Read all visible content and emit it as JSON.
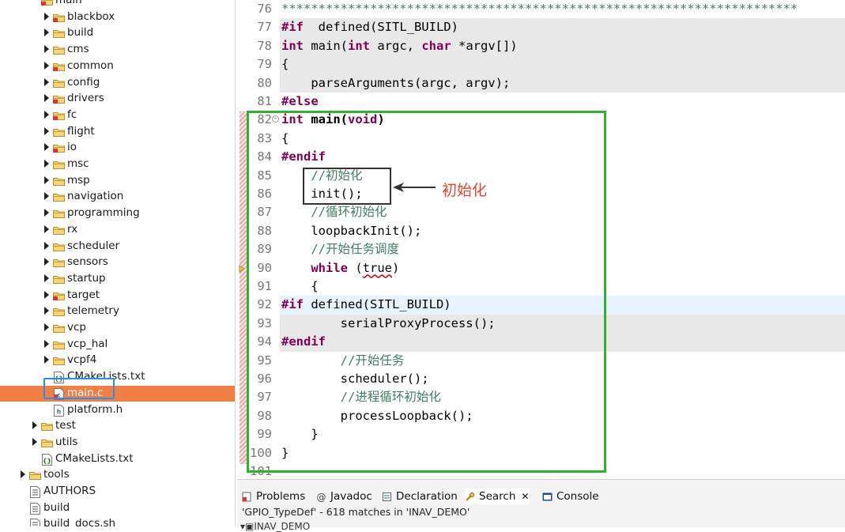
{
  "explorer": {
    "items": [
      {
        "label": "main",
        "type": "folder",
        "depth": 3,
        "arrow": false,
        "overlay": true
      },
      {
        "label": "blackbox",
        "type": "folder",
        "depth": 4,
        "arrow": true,
        "overlay": true
      },
      {
        "label": "build",
        "type": "folder",
        "depth": 4,
        "arrow": true,
        "overlay": false
      },
      {
        "label": "cms",
        "type": "folder",
        "depth": 4,
        "arrow": true,
        "overlay": false
      },
      {
        "label": "common",
        "type": "folder",
        "depth": 4,
        "arrow": true,
        "overlay": true
      },
      {
        "label": "config",
        "type": "folder",
        "depth": 4,
        "arrow": true,
        "overlay": false
      },
      {
        "label": "drivers",
        "type": "folder",
        "depth": 4,
        "arrow": true,
        "overlay": true
      },
      {
        "label": "fc",
        "type": "folder",
        "depth": 4,
        "arrow": true,
        "overlay": true
      },
      {
        "label": "flight",
        "type": "folder",
        "depth": 4,
        "arrow": true,
        "overlay": false
      },
      {
        "label": "io",
        "type": "folder",
        "depth": 4,
        "arrow": true,
        "overlay": true
      },
      {
        "label": "msc",
        "type": "folder",
        "depth": 4,
        "arrow": true,
        "overlay": false
      },
      {
        "label": "msp",
        "type": "folder",
        "depth": 4,
        "arrow": true,
        "overlay": false
      },
      {
        "label": "navigation",
        "type": "folder",
        "depth": 4,
        "arrow": true,
        "overlay": false
      },
      {
        "label": "programming",
        "type": "folder",
        "depth": 4,
        "arrow": true,
        "overlay": false
      },
      {
        "label": "rx",
        "type": "folder",
        "depth": 4,
        "arrow": true,
        "overlay": false
      },
      {
        "label": "scheduler",
        "type": "folder",
        "depth": 4,
        "arrow": true,
        "overlay": false
      },
      {
        "label": "sensors",
        "type": "folder",
        "depth": 4,
        "arrow": true,
        "overlay": false
      },
      {
        "label": "startup",
        "type": "folder",
        "depth": 4,
        "arrow": true,
        "overlay": false
      },
      {
        "label": "target",
        "type": "folder",
        "depth": 4,
        "arrow": true,
        "overlay": true
      },
      {
        "label": "telemetry",
        "type": "folder",
        "depth": 4,
        "arrow": true,
        "overlay": false
      },
      {
        "label": "vcp",
        "type": "folder",
        "depth": 4,
        "arrow": true,
        "overlay": false
      },
      {
        "label": "vcp_hal",
        "type": "folder",
        "depth": 4,
        "arrow": true,
        "overlay": false
      },
      {
        "label": "vcpf4",
        "type": "folder",
        "depth": 4,
        "arrow": true,
        "overlay": false
      },
      {
        "label": "CMakeLists.txt",
        "type": "cmake",
        "depth": 4,
        "arrow": false,
        "overlay": false
      },
      {
        "label": "main.c",
        "type": "cfile",
        "depth": 4,
        "arrow": false,
        "overlay": true,
        "selected": true
      },
      {
        "label": "platform.h",
        "type": "hfile",
        "depth": 4,
        "arrow": false,
        "overlay": false
      },
      {
        "label": "test",
        "type": "folder",
        "depth": 3,
        "arrow": true,
        "overlay": false
      },
      {
        "label": "utils",
        "type": "folder",
        "depth": 3,
        "arrow": true,
        "overlay": false
      },
      {
        "label": "CMakeLists.txt",
        "type": "cmake",
        "depth": 3,
        "arrow": false,
        "overlay": false
      },
      {
        "label": "tools",
        "type": "folder",
        "depth": 2,
        "arrow": true,
        "overlay": false
      },
      {
        "label": "AUTHORS",
        "type": "doc",
        "depth": 2,
        "arrow": false,
        "overlay": false
      },
      {
        "label": "build",
        "type": "doc",
        "depth": 2,
        "arrow": false,
        "overlay": false
      },
      {
        "label": "build_docs.sh",
        "type": "doc",
        "depth": 2,
        "arrow": false,
        "overlay": false
      }
    ]
  },
  "editor": {
    "lines": [
      {
        "n": "76",
        "hl": false,
        "segs": [
          [
            "cm",
            "**********************************************************************"
          ]
        ]
      },
      {
        "n": "77",
        "hl": true,
        "segs": [
          [
            "pre",
            "#if"
          ],
          [
            "",
            "  defined(SITL_BUILD)"
          ]
        ]
      },
      {
        "n": "78",
        "hl": true,
        "segs": [
          [
            "kw",
            "int"
          ],
          [
            "",
            " main("
          ],
          [
            "kw",
            "int"
          ],
          [
            "",
            " argc, "
          ],
          [
            "kw",
            "char"
          ],
          [
            "",
            " *argv[])"
          ]
        ]
      },
      {
        "n": "79",
        "hl": true,
        "segs": [
          [
            "",
            "{"
          ]
        ]
      },
      {
        "n": "80",
        "hl": true,
        "segs": [
          [
            "",
            "    parseArguments(argc, argv);"
          ]
        ]
      },
      {
        "n": "81",
        "hl": false,
        "segs": [
          [
            "pre",
            "#else"
          ]
        ]
      },
      {
        "n": "82",
        "hl": false,
        "fold": true,
        "segs": [
          [
            "kw",
            "int"
          ],
          [
            "",
            " "
          ],
          [
            "b",
            "main"
          ],
          [
            "",
            ""
          ],
          [
            "b",
            "("
          ],
          [
            "kw",
            "void"
          ],
          [
            "b",
            ")"
          ]
        ]
      },
      {
        "n": "83",
        "hl": false,
        "segs": [
          [
            "",
            "{"
          ]
        ]
      },
      {
        "n": "84",
        "hl": false,
        "segs": [
          [
            "pre",
            "#endif"
          ]
        ]
      },
      {
        "n": "85",
        "hl": false,
        "segs": [
          [
            "",
            "    "
          ],
          [
            "cm",
            "//初始化"
          ]
        ]
      },
      {
        "n": "86",
        "hl": false,
        "segs": [
          [
            "",
            "    init();"
          ]
        ]
      },
      {
        "n": "87",
        "hl": false,
        "segs": [
          [
            "",
            "    "
          ],
          [
            "cm",
            "//循环初始化"
          ]
        ]
      },
      {
        "n": "88",
        "hl": false,
        "segs": [
          [
            "",
            "    loopbackInit();"
          ]
        ]
      },
      {
        "n": "89",
        "hl": false,
        "segs": [
          [
            "",
            "    "
          ],
          [
            "cm",
            "//开始任务调度"
          ]
        ]
      },
      {
        "n": "90",
        "hl": false,
        "segs": [
          [
            "",
            "    "
          ],
          [
            "kw",
            "while"
          ],
          [
            "",
            " ("
          ],
          [
            "sq",
            "true"
          ],
          [
            "",
            ")"
          ]
        ]
      },
      {
        "n": "91",
        "hl": false,
        "segs": [
          [
            "",
            "    {"
          ]
        ]
      },
      {
        "n": "92",
        "hl": false,
        "cur": true,
        "segs": [
          [
            "pre",
            "#if"
          ],
          [
            "",
            " defined(SITL_BUILD)"
          ]
        ]
      },
      {
        "n": "93",
        "hl": true,
        "segs": [
          [
            "",
            "        serialProxyProcess();"
          ]
        ]
      },
      {
        "n": "94",
        "hl": true,
        "segs": [
          [
            "pre",
            "#endif"
          ]
        ]
      },
      {
        "n": "95",
        "hl": false,
        "segs": [
          [
            "",
            "        "
          ],
          [
            "cm",
            "//开始任务"
          ]
        ]
      },
      {
        "n": "96",
        "hl": false,
        "segs": [
          [
            "",
            "        scheduler();"
          ]
        ]
      },
      {
        "n": "97",
        "hl": false,
        "segs": [
          [
            "",
            "        "
          ],
          [
            "cm",
            "//进程循环初始化"
          ]
        ]
      },
      {
        "n": "98",
        "hl": false,
        "segs": [
          [
            "",
            "        processLoopback();"
          ]
        ]
      },
      {
        "n": "99",
        "hl": false,
        "segs": [
          [
            "",
            "    }"
          ]
        ]
      },
      {
        "n": "100",
        "hl": false,
        "segs": [
          [
            "",
            "}"
          ]
        ]
      },
      {
        "n": "101",
        "hl": false,
        "segs": []
      }
    ],
    "annotation": "初始化"
  },
  "panel": {
    "tabs": [
      {
        "label": "Problems",
        "icon": "problems-icon"
      },
      {
        "label": "Javadoc",
        "icon": "javadoc-icon"
      },
      {
        "label": "Declaration",
        "icon": "declaration-icon"
      },
      {
        "label": "Search",
        "icon": "search-icon",
        "active": true
      },
      {
        "label": "Console",
        "icon": "console-icon"
      }
    ],
    "status": "'GPIO_TypeDef' - 618 matches in 'INAV_DEMO'",
    "sub_item": "INAV_DEMO",
    "colors": {
      "selection": "#f07f45",
      "box_green": "#2fb32f",
      "box_blue": "#2d8cf0",
      "annotation_red": "#e8412c"
    }
  }
}
